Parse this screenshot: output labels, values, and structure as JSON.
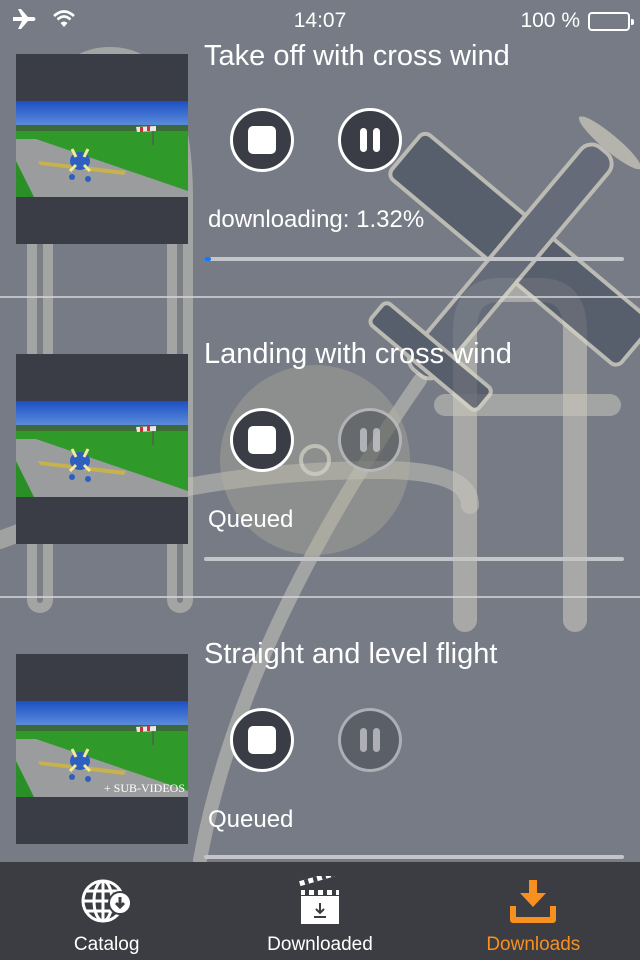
{
  "status_bar": {
    "airplane_mode_icon": "airplane-icon",
    "wifi_icon": "wifi-icon",
    "time": "14:07",
    "battery_percent": "100 %",
    "battery_level": 1.0
  },
  "downloads": [
    {
      "title": "Take off with cross wind",
      "status": "downloading: 1.32%",
      "progress_percent": 1.32,
      "pause_enabled": true,
      "thumbnail_overlay": ""
    },
    {
      "title": "Landing with cross wind",
      "status": "Queued",
      "progress_percent": 0,
      "pause_enabled": false,
      "thumbnail_overlay": ""
    },
    {
      "title": "Straight and level flight",
      "status": "Queued",
      "progress_percent": 0,
      "pause_enabled": false,
      "thumbnail_overlay": "+ SUB-VIDEOS"
    }
  ],
  "tab_bar": {
    "tabs": [
      {
        "label": "Catalog",
        "icon": "globe-download-icon",
        "active": false
      },
      {
        "label": "Downloaded",
        "icon": "clapperboard-icon",
        "active": false
      },
      {
        "label": "Downloads",
        "icon": "download-tray-icon",
        "active": true
      }
    ],
    "active_color": "#f7901e"
  },
  "colors": {
    "background": "#767b85",
    "progress_fill": "#1478fa",
    "tab_bar": "#3b3d42"
  }
}
